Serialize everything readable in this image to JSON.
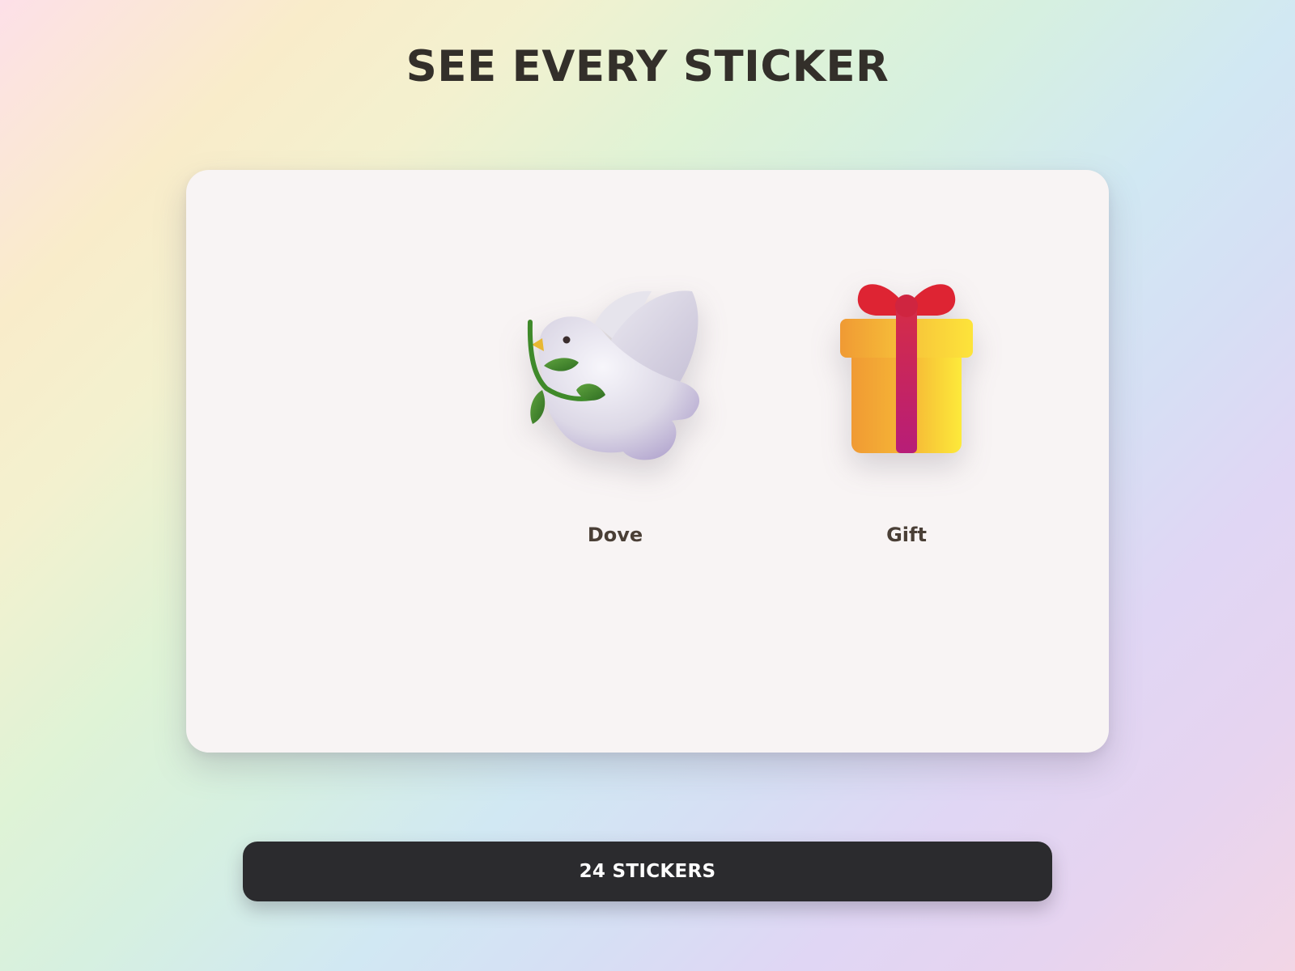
{
  "header": {
    "title": "SEE EVERY STICKER"
  },
  "stickers": [
    {
      "label": "Dove",
      "icon": "dove-with-olive-branch"
    },
    {
      "label": "Gift",
      "icon": "wrapped-gift"
    }
  ],
  "footer": {
    "count_label": "24 STICKERS"
  },
  "colors": {
    "title_text": "#332f2a",
    "label_text": "#4a3f36",
    "card_background": "#f8f4f4",
    "button_background": "#2b2b2e",
    "button_text": "#ffffff"
  }
}
